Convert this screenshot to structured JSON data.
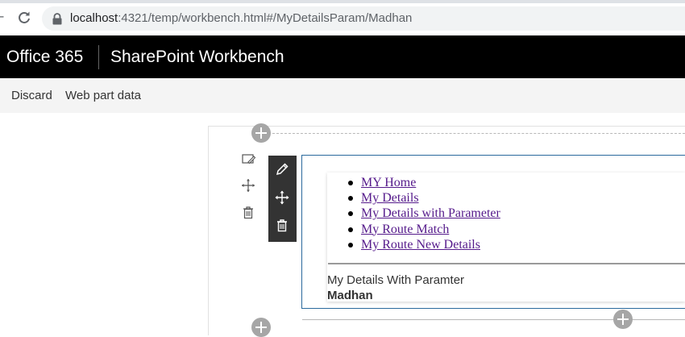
{
  "browser": {
    "url_host": "localhost",
    "url_rest": ":4321/temp/workbench.html#/MyDetailsParam/Madhan"
  },
  "suite": {
    "brand": "Office 365",
    "app": "SharePoint Workbench"
  },
  "commands": {
    "discard": "Discard",
    "webpart_data": "Web part data"
  },
  "webpart": {
    "links": [
      "MY Home",
      "My Details",
      "My Details with Parameter",
      "My Route Match",
      "My Route New Details"
    ],
    "subtitle": "My Details With Paramter",
    "param_value": "Madhan"
  },
  "colors": {
    "suite_bg": "#000000",
    "link": "#551a8b",
    "webpart_border": "#2b6a9d",
    "toolbar_bg": "#333333"
  }
}
